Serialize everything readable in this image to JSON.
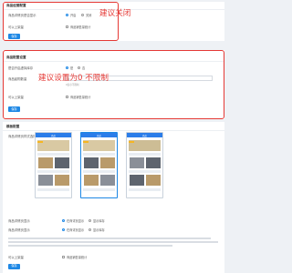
{
  "section1": {
    "title": "商品经营配置",
    "row1_label": "商品详情页是否显示",
    "row1_options": [
      "开启",
      "关闭"
    ],
    "row2_label": "可以上架量",
    "row2_checkbox": "商品销售量统计",
    "save_label": "保存",
    "annotation": "建议关闭"
  },
  "section2": {
    "title": "商品配置设置",
    "row1_label": "是否开启虚拟库存",
    "row1_options": [
      "是",
      "否"
    ],
    "row2_label": "商品起购数量",
    "row2_value": "0",
    "row2_help": "0表示不限制",
    "row3_label": "可以上架量",
    "row3_checkbox": "商品销售量统计",
    "save_label": "保存",
    "annotation": "建议设置为0 不限制"
  },
  "section3": {
    "title": "模板配置",
    "row1_label": "商品详情页样式选择",
    "phone_header": "商品",
    "row2_label": "商品详情页显示",
    "row2_options": [
      "在商详页显示",
      "显示库存"
    ],
    "row3_label": "商品详情页显示",
    "row3_options": [
      "在商详页显示",
      "显示库存"
    ],
    "row4_label": "可以上架量",
    "row4_checkbox": "商品销售量统计",
    "save_label": "保存"
  },
  "colors": {
    "accent": "#1e88e5",
    "annotation": "#e53935",
    "page_bg": "#eef1f5"
  }
}
